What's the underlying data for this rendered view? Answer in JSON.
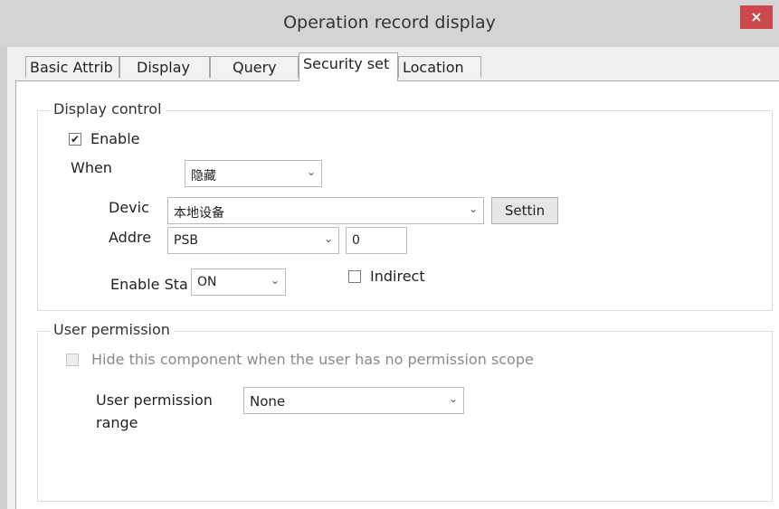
{
  "window": {
    "title": "Operation record display",
    "close_label": "×"
  },
  "tabs": [
    {
      "label": "Basic Attrib"
    },
    {
      "label": "Display"
    },
    {
      "label": "Query"
    },
    {
      "label": "Security set",
      "active": true
    },
    {
      "label": "Location"
    }
  ],
  "display_control": {
    "legend": "Display control",
    "enable_label": "Enable",
    "enable_checked": true,
    "enable_mark": "✔",
    "when_label": "When",
    "when_value": "隐藏",
    "device_label": "Devic",
    "device_value": "本地设备",
    "settings_button": "Settin",
    "address_label": "Addre",
    "address_value": "PSB",
    "address_number": "0",
    "enable_state_label": "Enable Sta",
    "enable_state_value": "ON",
    "indirect_label": "Indirect",
    "indirect_checked": false
  },
  "user_permission": {
    "legend": "User permission",
    "hide_label": "Hide this component when the user has no permission scope",
    "hide_checked": false,
    "range_label_line1": "User permission",
    "range_label_line2": "range",
    "range_value": "None"
  },
  "icons": {
    "dropdown": "chevron-down-icon",
    "check": "checkmark-icon"
  },
  "colors": {
    "close_button": "#c9494c",
    "titlebar": "#d4d4d4"
  }
}
